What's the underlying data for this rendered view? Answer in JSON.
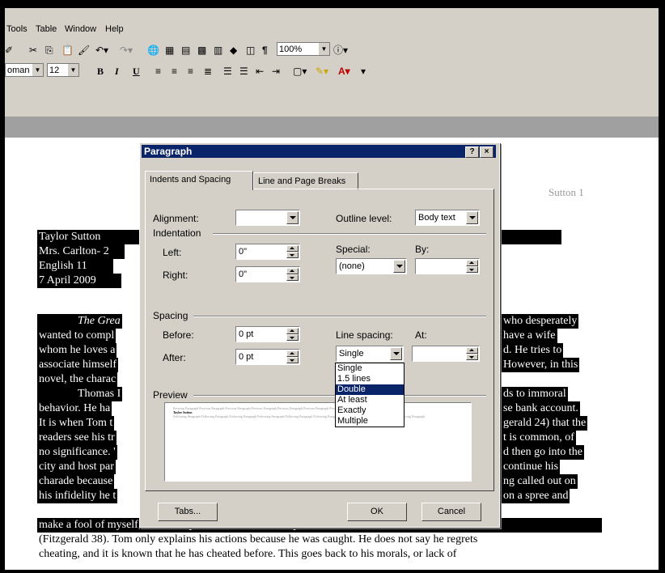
{
  "menubar": {
    "items": [
      "Tools",
      "Table",
      "Window",
      "Help"
    ]
  },
  "toolbar": {
    "zoom": "100%",
    "font_name": "oman",
    "font_size": "12",
    "bold": "B",
    "italic": "I",
    "underline": "U"
  },
  "document": {
    "header_right": "Sutton 1",
    "heading_lines": [
      "Taylor Sutton",
      "Mrs. Carlton- 2",
      "English 11",
      "7 April 2009"
    ],
    "body_left": [
      "The Grea",
      "wanted to compl",
      "whom he loves a",
      "associate himself",
      "novel, the charac",
      "Thomas I",
      "behavior.  He ha",
      "It is when Tom t",
      "readers see his tr",
      "no significance. '",
      "city and host par",
      "charade because",
      "his infidelity he t"
    ],
    "body_right": [
      "who desperately",
      "have a wife",
      "d. He tries to",
      "However, in this",
      "",
      "ds to immoral",
      "se bank account.",
      "gerald 24) that the",
      "t is common, of",
      "d then go into the",
      "continue his",
      "ng called out on",
      "on a spree and"
    ],
    "full_lines": [
      "make a fool of myself, but I always come back and in my heart I love her all of the time\"",
      "(Fitzgerald 38). Tom only explains his actions because he was caught. He does not say he regrets",
      "cheating, and it is known that he has cheated before. This goes back to his morals, or lack of"
    ]
  },
  "dialog": {
    "title": "Paragraph",
    "help_btn": "?",
    "close_btn": "×",
    "tabs": [
      "Indents and Spacing",
      "Line and Page Breaks"
    ],
    "alignment_label": "Alignment:",
    "alignment_value": "",
    "outline_label": "Outline level:",
    "outline_value": "Body text",
    "indentation_label": "Indentation",
    "left_label": "Left:",
    "left_value": "0\"",
    "right_label": "Right:",
    "right_value": "0\"",
    "special_label": "Special:",
    "special_value": "(none)",
    "by_label": "By:",
    "by_value": "",
    "spacing_label": "Spacing",
    "before_label": "Before:",
    "before_value": "0 pt",
    "after_label": "After:",
    "after_value": "0 pt",
    "line_spacing_label": "Line spacing:",
    "line_spacing_value": "Single",
    "at_label": "At:",
    "at_value": "",
    "line_spacing_options": [
      "Single",
      "1.5 lines",
      "Double",
      "At least",
      "Exactly",
      "Multiple"
    ],
    "line_spacing_highlighted": "Double",
    "preview_label": "Preview",
    "preview_prev": "Previous Paragraph Previous Paragraph Previous Paragraph Previous Paragraph Previous Paragraph Previous Paragraph Previous Paragraph Previous Paragraph",
    "preview_sample": "Taylor Sutton",
    "preview_next": "Following Paragraph Following Paragraph Following Paragraph Following Paragraph Following Paragraph Following Paragraph Following Paragraph Following Paragraph Following Paragraph",
    "tabs_button": "Tabs...",
    "ok_button": "OK",
    "cancel_button": "Cancel"
  }
}
